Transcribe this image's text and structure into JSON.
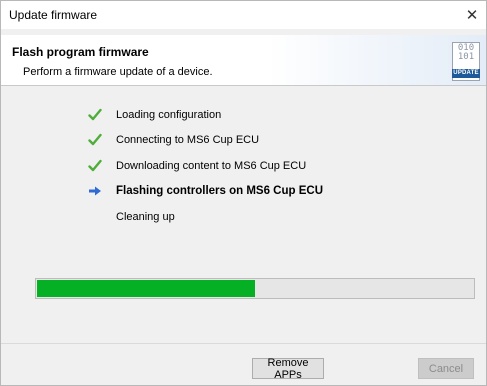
{
  "window": {
    "title": "Update firmware",
    "close_glyph": "✕"
  },
  "header": {
    "title": "Flash program firmware",
    "subtitle": "Perform a firmware update of a device.",
    "icon": {
      "name": "firmware-update-icon",
      "bits_line1": "010",
      "bits_line2": "101",
      "tag": "UPDATE"
    }
  },
  "steps": [
    {
      "label": "Loading configuration",
      "status": "done"
    },
    {
      "label": "Connecting to MS6 Cup ECU",
      "status": "done"
    },
    {
      "label": "Downloading content to MS6 Cup ECU",
      "status": "done"
    },
    {
      "label": "Flashing controllers on MS6 Cup ECU",
      "status": "active"
    },
    {
      "label": "Cleaning up",
      "status": "pending"
    }
  ],
  "progress": {
    "fraction": 0.5
  },
  "buttons": {
    "remove_apps": "Remove APPs",
    "cancel": "Cancel"
  },
  "colors": {
    "check": "#4fae3a",
    "arrow": "#2f6bd2",
    "progress_fill": "#06b025",
    "update_tag": "#1e5a9a"
  }
}
